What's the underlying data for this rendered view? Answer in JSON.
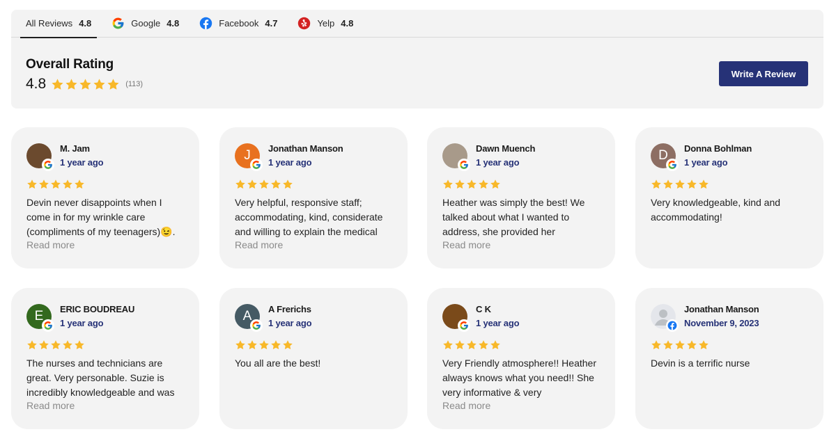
{
  "tabs": [
    {
      "label": "All Reviews",
      "score": "4.8",
      "icon": null
    },
    {
      "label": "Google",
      "score": "4.8",
      "icon": "google-icon"
    },
    {
      "label": "Facebook",
      "score": "4.7",
      "icon": "facebook-icon"
    },
    {
      "label": "Yelp",
      "score": "4.8",
      "icon": "yelp-icon"
    }
  ],
  "overall": {
    "title": "Overall Rating",
    "score": "4.8",
    "stars": 5,
    "count": "(113)"
  },
  "write_button": "Write A Review",
  "read_more_label": "Read more",
  "colors": {
    "accent": "#263277",
    "star": "#f8b829",
    "panel": "#f3f3f3"
  },
  "reviews": [
    {
      "name": "M. Jam",
      "date": "1 year ago",
      "source": "google",
      "avatar_letter": "",
      "avatar_color": "#6b4a2e",
      "stars": 5,
      "text": "Devin never disappoints when I come in for my wrinkle care (compliments of my teenagers)😉.",
      "read_more": true
    },
    {
      "name": "Jonathan Manson",
      "date": "1 year ago",
      "source": "google",
      "avatar_letter": "J",
      "avatar_color": "#e8711f",
      "stars": 5,
      "text": "Very helpful, responsive staff; accommodating, kind, considerate and willing to explain the medical",
      "read_more": true
    },
    {
      "name": "Dawn Muench",
      "date": "1 year ago",
      "source": "google",
      "avatar_letter": "",
      "avatar_color": "#a89a8a",
      "stars": 5,
      "text": "Heather was simply the best! We talked about what I wanted to address, she provided her",
      "read_more": true
    },
    {
      "name": "Donna Bohlman",
      "date": "1 year ago",
      "source": "google",
      "avatar_letter": "D",
      "avatar_color": "#8d6e63",
      "stars": 5,
      "text": "Very knowledgeable, kind and accommodating!",
      "read_more": false
    },
    {
      "name": "ERIC BOUDREAU",
      "date": "1 year ago",
      "source": "google",
      "avatar_letter": "E",
      "avatar_color": "#33691e",
      "stars": 5,
      "text": "The nurses and technicians are great. Very personable. Suzie is incredibly knowledgeable and was",
      "read_more": true
    },
    {
      "name": "A Frerichs",
      "date": "1 year ago",
      "source": "google",
      "avatar_letter": "A",
      "avatar_color": "#455a64",
      "stars": 5,
      "text": "You all are the best!",
      "read_more": false
    },
    {
      "name": "C K",
      "date": "1 year ago",
      "source": "google",
      "avatar_letter": "",
      "avatar_color": "#7a4a1a",
      "stars": 5,
      "text": "Very Friendly atmosphere!! Heather always knows what you need!! She very informative & very",
      "read_more": true
    },
    {
      "name": "Jonathan Manson",
      "date": "November 9, 2023",
      "source": "facebook",
      "avatar_letter": "",
      "avatar_color": "#e4e6eb",
      "stars": 5,
      "text": "Devin is a terrific nurse",
      "read_more": false
    }
  ]
}
